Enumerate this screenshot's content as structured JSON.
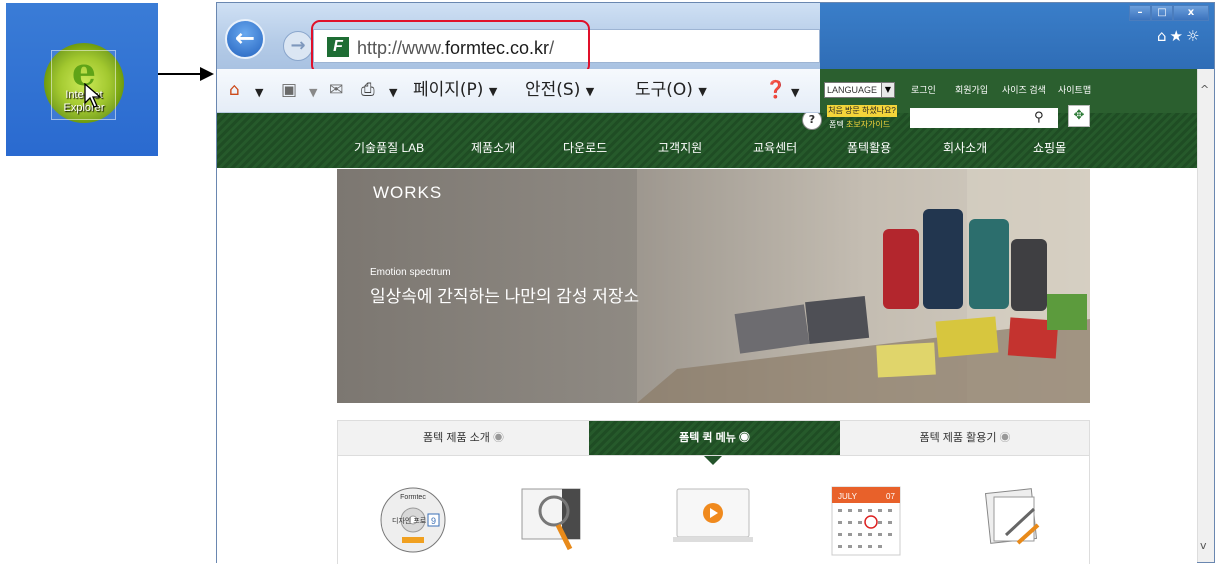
{
  "desktop": {
    "icon_label": "Internet Explorer",
    "icon_name": "internet-explorer-icon"
  },
  "browser": {
    "address_bar": {
      "url_prefix": "http://www.",
      "url_domain": "formtec.co.kr",
      "url_suffix": "/",
      "favicon_letter": "F"
    },
    "nav": {
      "back_glyph": "←",
      "forward_glyph": "→"
    },
    "window_controls": [
      "–",
      "□",
      "x"
    ],
    "right_icons": "⌂★☼",
    "command_bar": {
      "page": "페이지(P)",
      "safety": "안전(S)",
      "tools": "도구(O)"
    }
  },
  "site": {
    "language_select": "LANGUAGE",
    "top_links": [
      "로그인",
      "회원가입",
      "사이즈 검색",
      "사이트맵"
    ],
    "first_visit_badge": "처음 방문 하셨나요?",
    "guide_prefix": "폼텍",
    "guide_label": "초보자가이드",
    "menu": [
      "기술품질 LAB",
      "제품소개",
      "다운로드",
      "고객지원",
      "교육센터",
      "폼텍활용",
      "회사소개",
      "쇼핑몰"
    ],
    "hero": {
      "heading": "WORKS",
      "subtitle": "Emotion spectrum",
      "title": "일상속에 간직하는 나만의 감성 저장소"
    },
    "tabs": [
      "폼텍 제품 소개",
      "폼텍 퀵 메뉴",
      "폼텍 제품 활용기"
    ],
    "tab_active_index": 1,
    "calendar": {
      "month": "JULY",
      "day": "07"
    },
    "cd_brand": "Formtec",
    "cd_label": "디자인 프로",
    "cd_version": "9"
  },
  "colors": {
    "site_green": "#265a2b",
    "focus_red": "#e0102a",
    "ie_green": "#5fa317",
    "title_blue": "#2f6db6"
  }
}
